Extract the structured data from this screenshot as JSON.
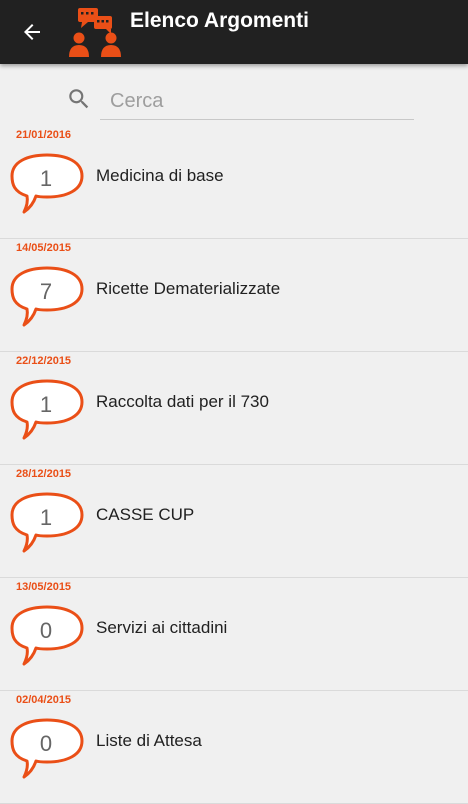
{
  "app_bar": {
    "title": "Elenco Argomenti",
    "back_icon": "arrow-back-icon",
    "logo_icon": "chat-people-logo-icon",
    "background": "#212121"
  },
  "search": {
    "placeholder": "Cerca",
    "value": "",
    "icon": "search-icon"
  },
  "accent_color": "#ea4f17",
  "topics": [
    {
      "date": "21/01/2016",
      "count": "1",
      "title": "Medicina di base"
    },
    {
      "date": "14/05/2015",
      "count": "7",
      "title": "Ricette Dematerializzate"
    },
    {
      "date": "22/12/2015",
      "count": "1",
      "title": "Raccolta dati per il 730"
    },
    {
      "date": "28/12/2015",
      "count": "1",
      "title": "CASSE CUP"
    },
    {
      "date": "13/05/2015",
      "count": "0",
      "title": "Servizi ai cittadini"
    },
    {
      "date": "02/04/2015",
      "count": "0",
      "title": "Liste di Attesa"
    }
  ]
}
